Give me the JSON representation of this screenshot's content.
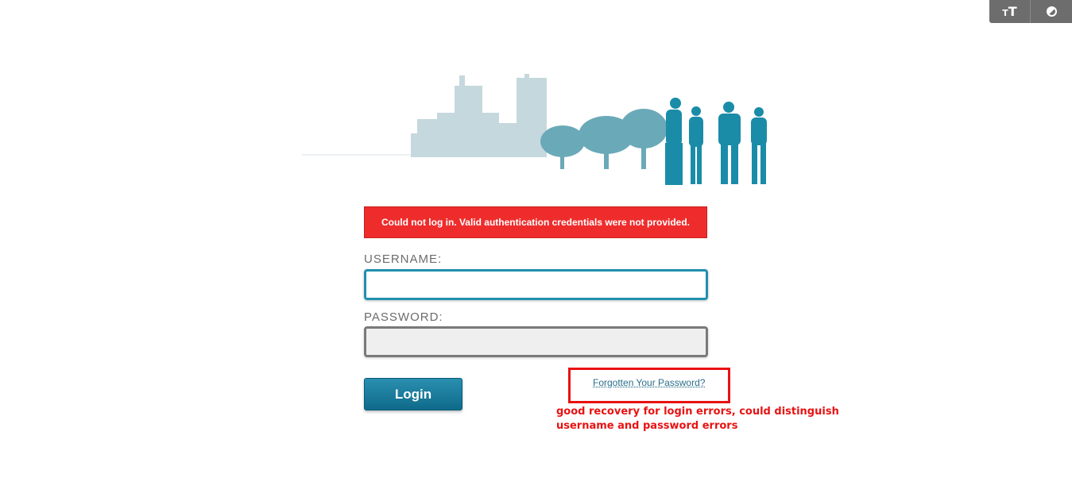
{
  "toolbar": {
    "text_size": {
      "small": "T",
      "big": "T",
      "icon": "text-size-icon"
    },
    "contrast": {
      "icon": "contrast-icon"
    }
  },
  "error": {
    "message": "Could not log in. Valid authentication credentials were not provided."
  },
  "form": {
    "username_label": "USERNAME:",
    "username_value": "",
    "password_label": "PASSWORD:",
    "password_value": "",
    "login_label": "Login",
    "forgot_label": "Forgotten Your Password?"
  },
  "annotation": {
    "note": "good recovery for login errors, could distinguish username and password errors"
  },
  "colors": {
    "error_bg": "#ef2c2c",
    "accent": "#1f8fb0",
    "annotation": "#e81212",
    "skyline": "#c5d8dd",
    "trees": "#6aa9b8",
    "people": "#1a8ca8"
  }
}
